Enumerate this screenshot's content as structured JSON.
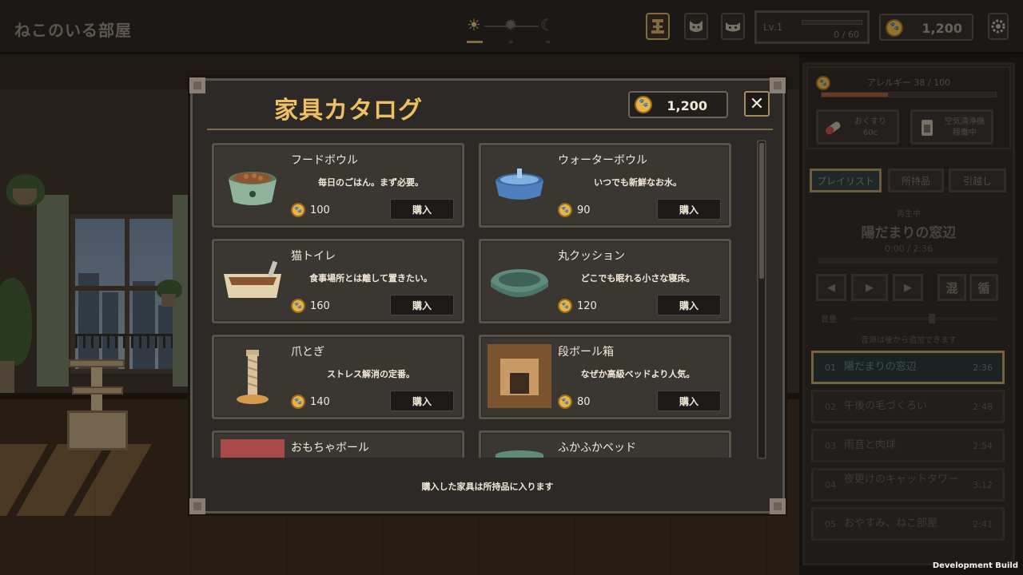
{
  "room_title": "ねこのいる部屋",
  "time_of_day": [
    "morning-sun-icon",
    "noon-sun-icon",
    "night-moon-icon"
  ],
  "level": {
    "label": "Lv.1",
    "xp": "0 / 60",
    "progress": 0
  },
  "coins": "1,200",
  "allergy": {
    "label": "アレルギー 38 / 100",
    "value": 38,
    "max": 100
  },
  "side_actions": [
    {
      "label": "おくすり\n60c"
    },
    {
      "label": "空気清浄機\n稼働中"
    }
  ],
  "tabs": [
    "プレイリスト",
    "所持品",
    "引越し"
  ],
  "player": {
    "now_playing_label": "再生中",
    "title": "陽だまりの窓辺",
    "time": "0:00 / 2:36",
    "shuffle_label": "混",
    "loop_label": "循",
    "volume_label": "音量",
    "volume": 0.55,
    "hint": "音源は後から追加できます"
  },
  "playlist": [
    {
      "no": "01",
      "name": "陽だまりの窓辺",
      "duration": "2:36"
    },
    {
      "no": "02",
      "name": "午後の毛づくろい",
      "duration": "2:48"
    },
    {
      "no": "03",
      "name": "雨音と肉球",
      "duration": "2:54"
    },
    {
      "no": "04",
      "name": "夜更けのキャットタワー",
      "duration": "3:12"
    },
    {
      "no": "05",
      "name": "おやすみ、ねこ部屋",
      "duration": "2:41"
    }
  ],
  "catalog": {
    "title": "家具カタログ",
    "coins": "1,200",
    "close_label": "✕",
    "buy_label": "購入",
    "footer": "購入した家具は所持品に入ります",
    "items": [
      {
        "name": "フードボウル",
        "desc": "毎日のごはん。まず必要。",
        "price": "100",
        "icon": "food-bowl-icon"
      },
      {
        "name": "ウォーターボウル",
        "desc": "いつでも新鮮なお水。",
        "price": "90",
        "icon": "water-bowl-icon"
      },
      {
        "name": "猫トイレ",
        "desc": "食事場所とは離して置きたい。",
        "price": "160",
        "icon": "litter-box-icon"
      },
      {
        "name": "丸クッション",
        "desc": "どこでも眠れる小さな寝床。",
        "price": "120",
        "icon": "round-cushion-icon"
      },
      {
        "name": "爪とぎ",
        "desc": "ストレス解消の定番。",
        "price": "140",
        "icon": "scratching-post-icon"
      },
      {
        "name": "段ボール箱",
        "desc": "なぜか高級ベッドより人気。",
        "price": "80",
        "icon": "cardboard-box-icon"
      },
      {
        "name": "おもちゃボール",
        "desc": "",
        "price": "",
        "icon": "toy-ball-icon"
      },
      {
        "name": "ふかふかベッド",
        "desc": "",
        "price": "",
        "icon": "fluffy-bed-icon"
      }
    ]
  },
  "dev_build": "Development Build",
  "colors": {
    "accent": "#efc061",
    "coin": "#e7b445",
    "panel": "#2c2926"
  }
}
